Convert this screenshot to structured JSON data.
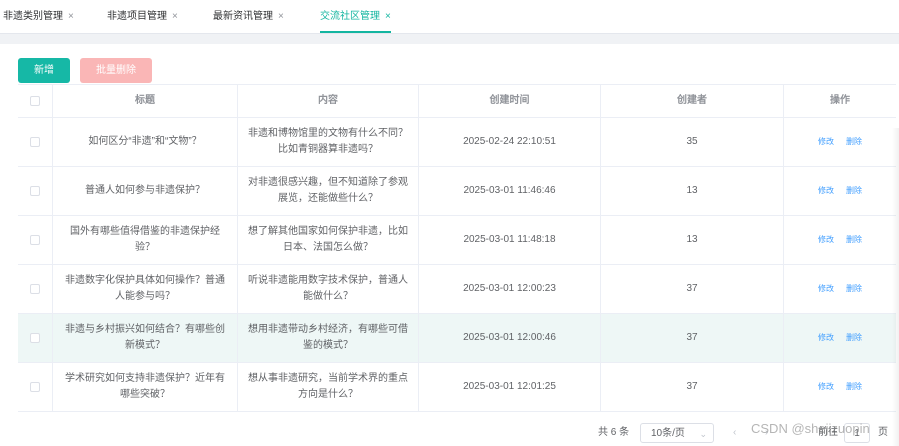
{
  "tabs": [
    {
      "label": "非遗类别管理",
      "close": "×"
    },
    {
      "label": "非遗项目管理",
      "close": "×"
    },
    {
      "label": "最新资讯管理",
      "close": "×"
    },
    {
      "label": "交流社区管理",
      "close": "×"
    }
  ],
  "toolbar": {
    "add_label": "新增",
    "batch_delete_label": "批量删除"
  },
  "table": {
    "headers": {
      "title": "标题",
      "content": "内容",
      "created_at": "创建时间",
      "creator": "创建者",
      "actions": "操作"
    },
    "rows": [
      {
        "title": "如何区分“非遗”和“文物”？",
        "content": "非遗和博物馆里的文物有什么不同？比如青铜器算非遗吗？",
        "created_at": "2025-02-24 22:10:51",
        "creator": "35",
        "edit": "修改",
        "delete": "删除"
      },
      {
        "title": "普通人如何参与非遗保护？",
        "content": "对非遗很感兴趣，但不知道除了参观展览，还能做些什么？",
        "created_at": "2025-03-01 11:46:46",
        "creator": "13",
        "edit": "修改",
        "delete": "删除"
      },
      {
        "title": "国外有哪些值得借鉴的非遗保护经验？",
        "content": "想了解其他国家如何保护非遗，比如日本、法国怎么做？",
        "created_at": "2025-03-01 11:48:18",
        "creator": "13",
        "edit": "修改",
        "delete": "删除"
      },
      {
        "title": "非遗数字化保护具体如何操作？普通人能参与吗？",
        "content": "听说非遗能用数字技术保护，普通人能做什么？",
        "created_at": "2025-03-01 12:00:23",
        "creator": "37",
        "edit": "修改",
        "delete": "删除"
      },
      {
        "title": "非遗与乡村振兴如何结合？有哪些创新模式？",
        "content": "想用非遗带动乡村经济，有哪些可借鉴的模式？",
        "created_at": "2025-03-01 12:00:46",
        "creator": "37",
        "edit": "修改",
        "delete": "删除"
      },
      {
        "title": "学术研究如何支持非遗保护？近年有哪些突破？",
        "content": "想从事非遗研究，当前学术界的重点方向是什么？",
        "created_at": "2025-03-01 12:01:25",
        "creator": "37",
        "edit": "修改",
        "delete": "删除"
      }
    ]
  },
  "pagination": {
    "total": "共 6 条",
    "page_size": "10条/页",
    "dropdown_arrow": "⌄",
    "prev": "‹",
    "next": "›",
    "goto_label": "前往",
    "jump_value": "1",
    "page_suffix": "页"
  },
  "watermark": "CSDN @shejizuopin",
  "colors": {
    "accent": "#16b8a6",
    "danger_light": "#fab6b6",
    "link": "#409eff"
  }
}
